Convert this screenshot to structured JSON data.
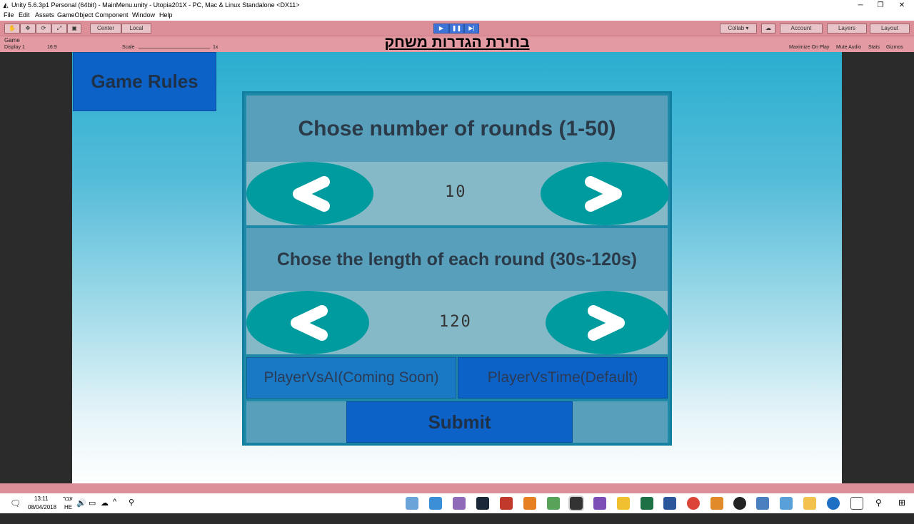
{
  "window": {
    "title": "Unity 5.6.3p1 Personal (64bit) - MainMenu.unity - Utopia201X - PC, Mac & Linux Standalone <DX11>",
    "minimize": "─",
    "restore": "❐",
    "close": "✕"
  },
  "menu": [
    "File",
    "Edit",
    "Assets",
    "GameObject",
    "Component",
    "Window",
    "Help"
  ],
  "toolbar": {
    "center_label": "Center",
    "local_label": "Local",
    "collab_label": "Collab ▾",
    "account_label": "Account",
    "layers_label": "Layers",
    "layout_label": "Layout"
  },
  "game_tab": {
    "tab_label": "Game",
    "display": "Display 1",
    "aspect": "16:9",
    "scale_label": "Scale",
    "scale_value": "1x",
    "maximize_on_play": "Maximize On Play",
    "mute_audio": "Mute Audio",
    "stats": "Stats",
    "gizmos": "Gizmos"
  },
  "heading_hebrew": "בחירת הגדרות משחק",
  "game": {
    "rules_button": "Game Rules",
    "rounds": {
      "heading": "Chose number of rounds (1-50)",
      "value": "10"
    },
    "length": {
      "heading": "Chose the length of each round (30s-120s)",
      "value": "120"
    },
    "mode_ai": "PlayerVsAI(Coming Soon)",
    "mode_time": "PlayerVsTime(Default)",
    "submit": "Submit"
  },
  "colors": {
    "button_blue": "#0d62c8",
    "arrow_teal": "#009b9e",
    "panel_head": "#579fba",
    "panel_row": "#86b9c8"
  },
  "taskbar": {
    "time": "13:11",
    "date": "08/04/2018",
    "lang_top": "עבר",
    "lang_bottom": "HE"
  }
}
